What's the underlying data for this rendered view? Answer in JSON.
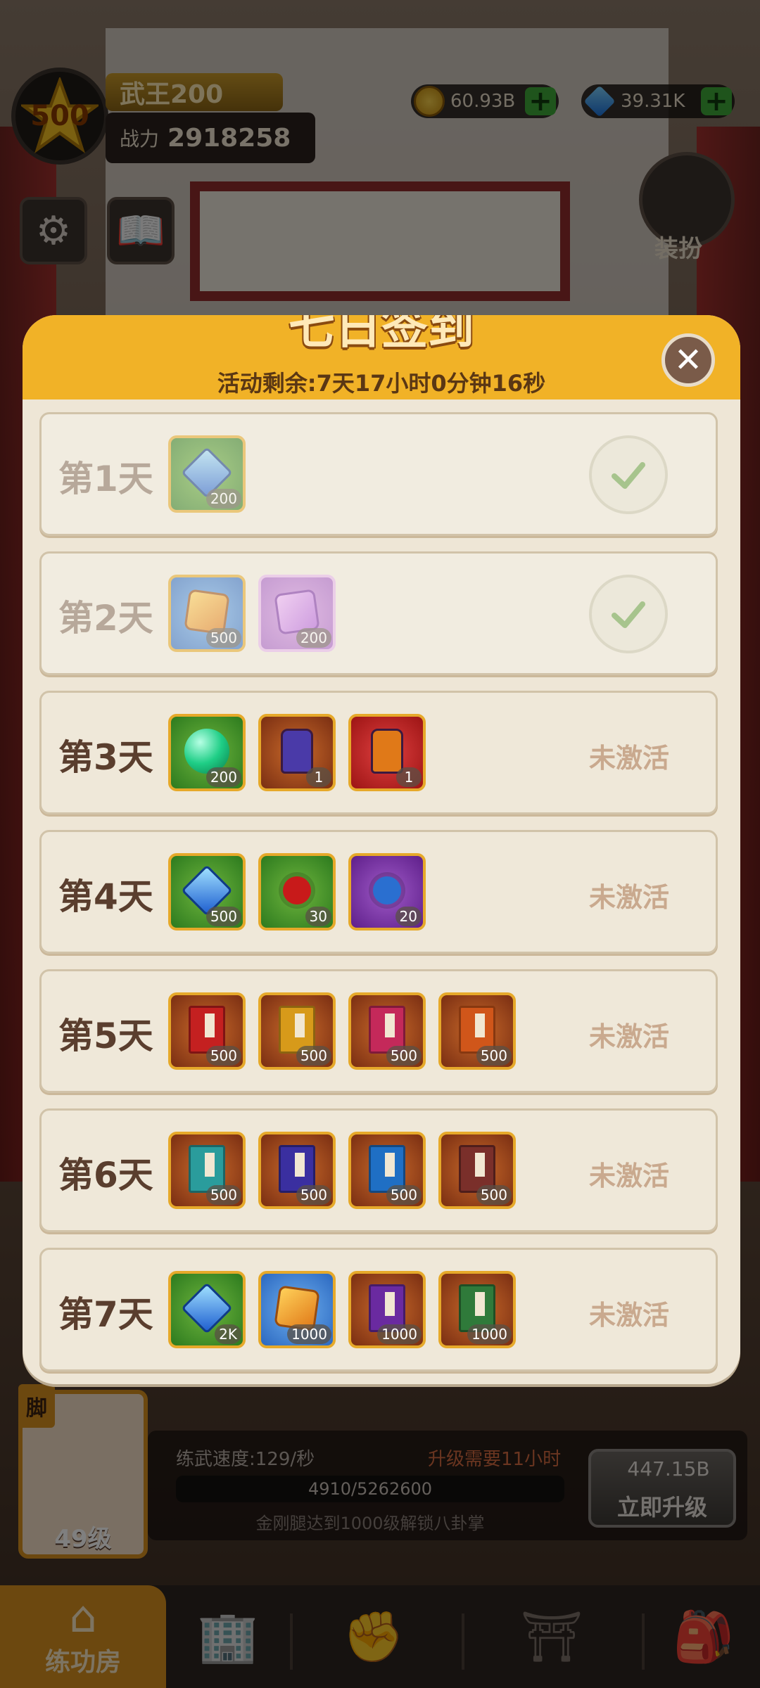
{
  "player": {
    "level": "500",
    "name": "武王200",
    "power_label": "战力",
    "power_value": "2918258"
  },
  "currency": {
    "gold": "60.93B",
    "gems": "39.31K"
  },
  "side": {
    "skin_label": "装扮"
  },
  "modal": {
    "title": "七日签到",
    "remaining": "活动剩余:7天17小时0分钟16秒",
    "rows": [
      {
        "day": "第1天",
        "state": "done",
        "items": [
          {
            "icon": "blue-gem-icon",
            "qty": "200"
          }
        ]
      },
      {
        "day": "第2天",
        "state": "done",
        "items": [
          {
            "icon": "orange-crystal-icon",
            "qty": "500"
          },
          {
            "icon": "purple-bolt-crystal-icon",
            "qty": "200"
          }
        ]
      },
      {
        "day": "第3天",
        "status": "未激活",
        "items": [
          {
            "icon": "green-orb-icon",
            "qty": "200"
          },
          {
            "icon": "blue-talisman-icon",
            "qty": "1"
          },
          {
            "icon": "orange-talisman-icon",
            "qty": "1"
          }
        ]
      },
      {
        "day": "第4天",
        "status": "未激活",
        "items": [
          {
            "icon": "blue-gem-icon",
            "qty": "500"
          },
          {
            "icon": "red-rose-icon",
            "qty": "30"
          },
          {
            "icon": "blue-rose-icon",
            "qty": "20"
          }
        ]
      },
      {
        "day": "第5天",
        "status": "未激活",
        "items": [
          {
            "icon": "red-book-icon",
            "qty": "500"
          },
          {
            "icon": "yellow-book-icon",
            "qty": "500"
          },
          {
            "icon": "pink-book-icon",
            "qty": "500"
          },
          {
            "icon": "orange-book-icon",
            "qty": "500"
          }
        ]
      },
      {
        "day": "第6天",
        "status": "未激活",
        "items": [
          {
            "icon": "teal-book-icon",
            "qty": "500"
          },
          {
            "icon": "indigo-book-icon",
            "qty": "500"
          },
          {
            "icon": "blue-book-icon",
            "qty": "500"
          },
          {
            "icon": "brown-book-icon",
            "qty": "500"
          }
        ]
      },
      {
        "day": "第7天",
        "status": "未激活",
        "items": [
          {
            "icon": "blue-gem-icon",
            "qty": "2K"
          },
          {
            "icon": "orange-crystal-icon",
            "qty": "1000"
          },
          {
            "icon": "purple-book-icon",
            "qty": "1000"
          },
          {
            "icon": "green-book-icon",
            "qty": "1000"
          }
        ]
      }
    ]
  },
  "training": {
    "tag": "脚",
    "level": "49级",
    "speed": "练武速度:129/秒",
    "need": "升级需要11小时",
    "progress": "4910/5262600",
    "unlock": "金刚腿达到1000级解锁八卦掌",
    "cost": "447.15B",
    "upgrade_label": "立即升级"
  },
  "nav": {
    "home_label": "练功房"
  },
  "colors": {
    "modal_header": "#f1b227",
    "modal_bg": "#eee6d6",
    "nav_active": "#d8911f"
  }
}
